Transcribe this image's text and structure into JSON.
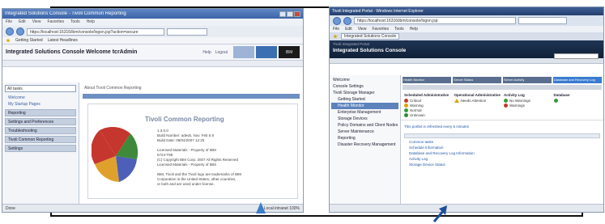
{
  "win1": {
    "title": "Integrated Solutions Console - Tivoli Common Reporting",
    "menu": [
      "File",
      "Edit",
      "View",
      "Favorites",
      "Tools",
      "Help"
    ],
    "address": "https://localhost:16316/ibm/console/logon.jsp?action=secure",
    "favorites": [
      "Getting Started",
      "Latest Headlines"
    ],
    "app_title": "Integrated Solutions Console Welcome tcrAdmin",
    "header_links": [
      "Help",
      "Logout"
    ],
    "header_box": "IBM",
    "view_select": "All tasks",
    "nav_links": [
      "Welcome",
      "My Startup Pages"
    ],
    "nav_tasks": [
      "Reporting",
      "Settings and Preferences",
      "Troubleshooting",
      "Tivoli Common Reporting",
      "Settings"
    ],
    "crumb": "About Tivoli Common Reporting",
    "product_title": "Tivoli Common Reporting",
    "version_lines": [
      "1.3.0.0",
      "Build Number: adevb, Nov. Feb 5 8",
      "Build Date: 09/04/2007 12:25",
      "",
      "Licensed Materials - Property of IBM",
      "5724-T89",
      "(C) Copyright IBM Corp. 2007 All Rights Reserved",
      "Licensed Materials - Property of IBM",
      "",
      "IBM, Tivoli and the Tivoli logo are trademarks of IBM",
      "Corporation in the United States, other countries,",
      "or both and are used under license."
    ],
    "status_left": "Done",
    "status_right": "Local intranet  100%"
  },
  "win2": {
    "title": "Tivoli Integrated Portal - Windows Internet Explorer",
    "address": "https://localhost:16316/ibm/console/logon.jsp",
    "menu": [
      "File",
      "Edit",
      "View",
      "Favorites",
      "Tools",
      "Help"
    ],
    "tab": "Integrated Solutions Console",
    "hdr_small": "Tivoli Integrated Portal",
    "hdr_big": "Integrated Solutions Console",
    "tree": [
      "Welcome",
      "Console Settings",
      "Tivoli Storage Manager",
      "Getting Started",
      "Health Monitor",
      "Enterprise Management",
      "Storage Devices",
      "Policy Domains and Client Nodes",
      "Server Maintenance",
      "Reporting",
      "Disaster Recovery Management"
    ],
    "tabs": [
      "Health Monitor",
      "Server Status",
      "Server Activity",
      "Database and Recovery Log"
    ],
    "col_headers": [
      "Scheduled Administrative",
      "Operational Administrative",
      "Activity Log",
      "Database"
    ],
    "col1": [
      "Critical",
      "Warning",
      "Normal",
      "Unknown"
    ],
    "col2": [
      "Needs Attention"
    ],
    "col3": [
      "No Warnings",
      "Warnings"
    ],
    "message": "This portlet is refreshed every 5 minutes",
    "links": [
      "Common tasks",
      "Schedule Information",
      "Database and Recovery Log Information",
      "Activity Log",
      "Storage Device Status"
    ]
  }
}
